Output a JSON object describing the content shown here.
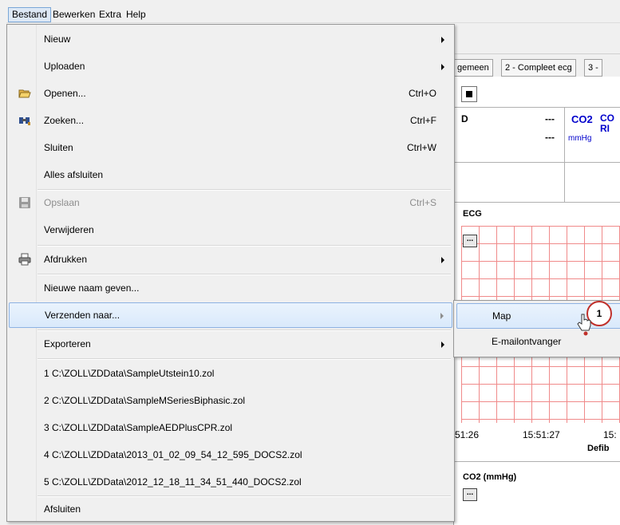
{
  "menubar": {
    "items": [
      "Bestand",
      "Bewerken",
      "Extra",
      "Help"
    ]
  },
  "background": {
    "tabs": [
      "gemeen",
      "2 - Compleet ecg",
      "3 -"
    ],
    "vitals": {
      "d_label": "D",
      "dash_1": "---",
      "dash_2": "---",
      "co2_label": "CO2",
      "co2_extra": "CO RI",
      "co2_unit": "mmHg"
    },
    "ecg_label": "ECG",
    "ellipsis": "...",
    "times": [
      "51:26",
      "15:51:27",
      "15:"
    ],
    "defib_label": "Defib",
    "co2_chart_label": "CO2 (mmHg)"
  },
  "menu": {
    "items": [
      {
        "label": "Nieuw",
        "shortcut": "",
        "submenu": true,
        "icon": ""
      },
      {
        "label": "Uploaden",
        "shortcut": "",
        "submenu": true,
        "icon": ""
      },
      {
        "label": "Openen...",
        "shortcut": "Ctrl+O",
        "submenu": false,
        "icon": "open-folder-icon"
      },
      {
        "label": "Zoeken...",
        "shortcut": "Ctrl+F",
        "submenu": false,
        "icon": "binoculars-icon"
      },
      {
        "label": "Sluiten",
        "shortcut": "Ctrl+W",
        "submenu": false,
        "icon": ""
      },
      {
        "label": "Alles afsluiten",
        "shortcut": "",
        "submenu": false,
        "icon": ""
      },
      {
        "label": "Opslaan",
        "shortcut": "Ctrl+S",
        "submenu": false,
        "icon": "save-disk-icon",
        "disabled": true
      },
      {
        "label": "Verwijderen",
        "shortcut": "",
        "submenu": false,
        "icon": ""
      },
      {
        "label": "Afdrukken",
        "shortcut": "",
        "submenu": true,
        "icon": "printer-icon"
      },
      {
        "label": "Nieuwe naam geven...",
        "shortcut": "",
        "submenu": false,
        "icon": ""
      },
      {
        "label": "Verzenden naar...",
        "shortcut": "",
        "submenu": true,
        "icon": "",
        "highlighted": true
      },
      {
        "label": "Exporteren",
        "shortcut": "",
        "submenu": true,
        "icon": ""
      },
      {
        "label": "1 C:\\ZOLL\\ZDData\\SampleUtstein10.zol",
        "shortcut": "",
        "submenu": false,
        "icon": ""
      },
      {
        "label": "2 C:\\ZOLL\\ZDData\\SampleMSeriesBiphasic.zol",
        "shortcut": "",
        "submenu": false,
        "icon": ""
      },
      {
        "label": "3 C:\\ZOLL\\ZDData\\SampleAEDPlusCPR.zol",
        "shortcut": "",
        "submenu": false,
        "icon": ""
      },
      {
        "label": "4 C:\\ZOLL\\ZDData\\2013_01_02_09_54_12_595_DOCS2.zol",
        "shortcut": "",
        "submenu": false,
        "icon": ""
      },
      {
        "label": "5 C:\\ZOLL\\ZDData\\2012_12_18_11_34_51_440_DOCS2.zol",
        "shortcut": "",
        "submenu": false,
        "icon": ""
      },
      {
        "label": "Afsluiten",
        "shortcut": "",
        "submenu": false,
        "icon": ""
      }
    ]
  },
  "submenu": {
    "items": [
      {
        "label": "Map",
        "highlighted": true
      },
      {
        "label": "E-mailontvanger",
        "highlighted": false
      }
    ]
  },
  "callout": {
    "number": "1",
    "color": "#c0302a"
  },
  "colors": {
    "highlight_border": "#8db2e3",
    "grid": "#f08a8a",
    "vital_blue": "#0000cc"
  }
}
